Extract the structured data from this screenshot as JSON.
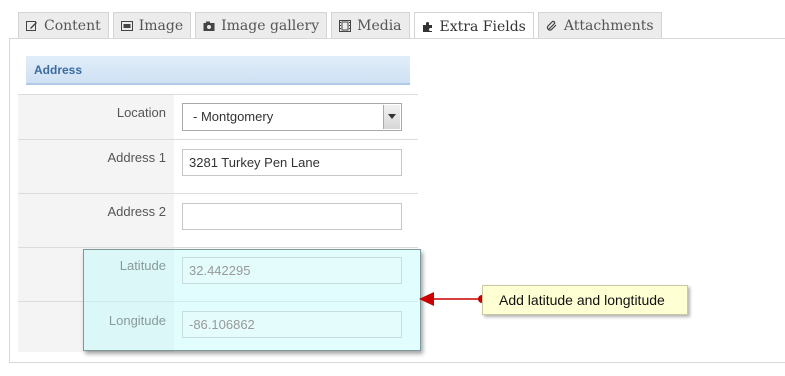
{
  "tabs": [
    {
      "label": "Content",
      "icon": "edit-icon",
      "active": false
    },
    {
      "label": "Image",
      "icon": "image-icon",
      "active": false
    },
    {
      "label": "Image gallery",
      "icon": "camera-icon",
      "active": false
    },
    {
      "label": "Media",
      "icon": "film-icon",
      "active": false
    },
    {
      "label": "Extra Fields",
      "icon": "puzzle-icon",
      "active": true
    },
    {
      "label": "Attachments",
      "icon": "paperclip-icon",
      "active": false
    }
  ],
  "section": {
    "title": "Address"
  },
  "fields": {
    "location": {
      "label": "Location",
      "value": "- Montgomery"
    },
    "address1": {
      "label": "Address 1",
      "value": "3281 Turkey Pen Lane"
    },
    "address2": {
      "label": "Address 2",
      "value": ""
    },
    "latitude": {
      "label": "Latitude",
      "value": "32.442295"
    },
    "longitude": {
      "label": "Longitude",
      "value": "-86.106862"
    }
  },
  "callout": {
    "text": "Add latitude and longtitude"
  },
  "colors": {
    "accent": "#cc0000",
    "header_text": "#3c6ba0",
    "highlight": "#bef9f9",
    "callout_bg": "#ffffd4"
  }
}
